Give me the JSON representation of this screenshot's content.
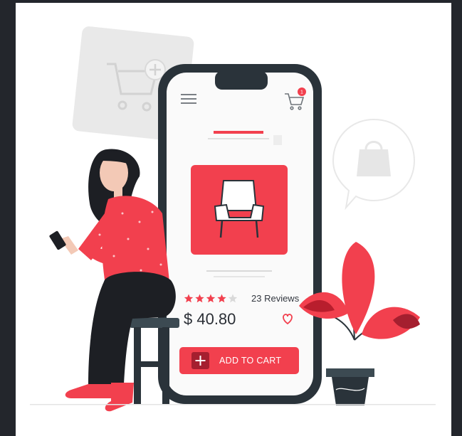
{
  "product": {
    "rating": 4,
    "max_rating": 5,
    "reviews_label": "23 Reviews",
    "price": "$ 40.80",
    "cart_badge": "1"
  },
  "actions": {
    "add_to_cart_label": "ADD TO CART"
  },
  "colors": {
    "accent": "#f2404e",
    "dark": "#2a333a",
    "star_empty": "#d9d9d9",
    "light_gray": "#e8e8e8"
  },
  "icons": {
    "menu": "hamburger-menu-icon",
    "cart": "shopping-cart-icon",
    "favorite": "heart-icon",
    "add": "plus-icon",
    "chair": "armchair-icon",
    "bag": "shopping-bag-icon"
  }
}
